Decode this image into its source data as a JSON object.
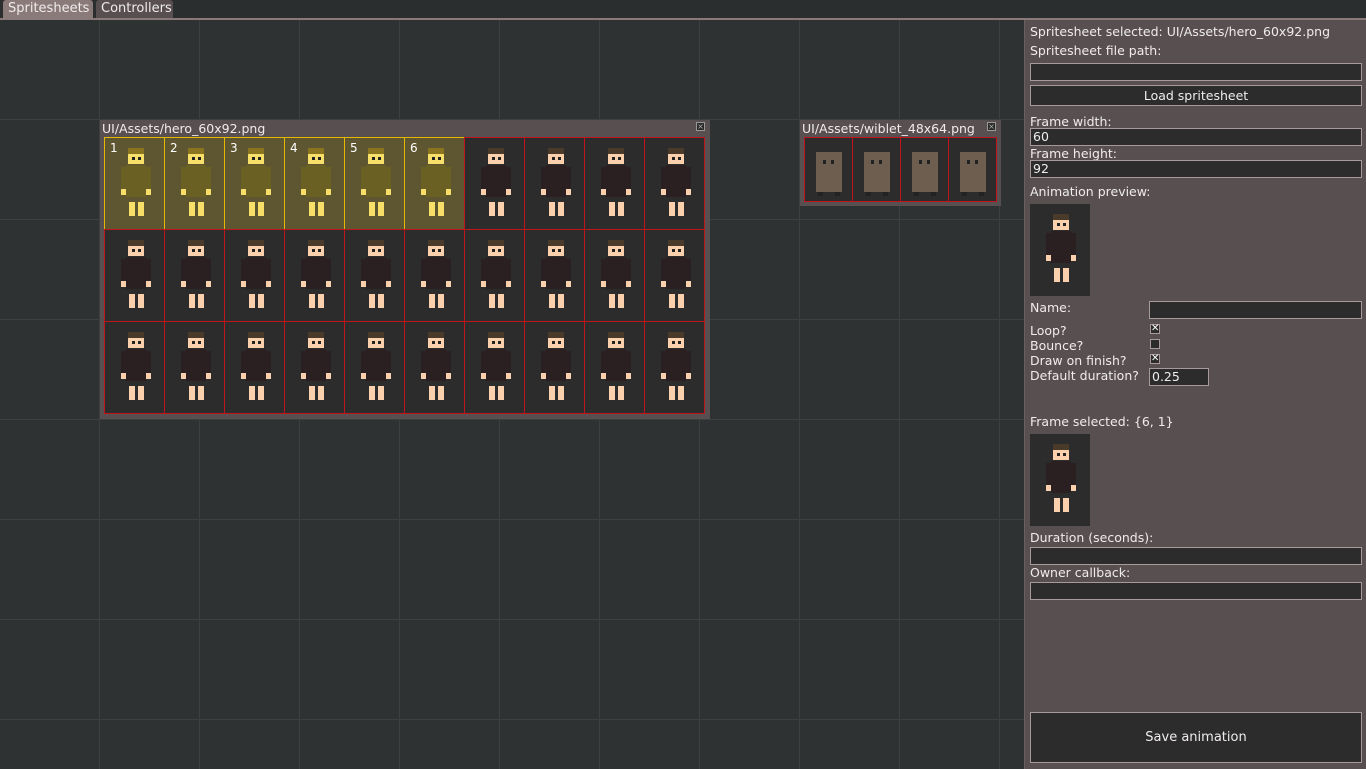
{
  "tabs": [
    {
      "label": "Spritesheets"
    },
    {
      "label": "Controllers"
    }
  ],
  "sheets": [
    {
      "title": "UI/Assets/hero_60x92.png",
      "cols": 10,
      "rows": 3,
      "selected_numbers": [
        "1",
        "2",
        "3",
        "4",
        "5",
        "6"
      ]
    },
    {
      "title": "UI/Assets/wiblet_48x64.png",
      "cols": 4,
      "rows": 1
    }
  ],
  "close_glyph": "×",
  "panel": {
    "spritesheet_selected": "Spritesheet selected: UI/Assets/hero_60x92.png",
    "file_path_label": "Spritesheet file path:",
    "file_path_value": "",
    "load_button": "Load spritesheet",
    "frame_width_label": "Frame width:",
    "frame_width_value": "60",
    "frame_height_label": "Frame height:",
    "frame_height_value": "92",
    "animation_preview_label": "Animation preview:",
    "name_label": "Name:",
    "name_value": "",
    "loop_label": "Loop?",
    "loop_checked": true,
    "bounce_label": "Bounce?",
    "bounce_checked": false,
    "draw_on_finish_label": "Draw on finish?",
    "draw_on_finish_checked": true,
    "default_duration_label": "Default duration?",
    "default_duration_value": "0.25",
    "frame_selected": "Frame selected: {6, 1}",
    "duration_label": "Duration (seconds):",
    "duration_value": "",
    "owner_callback_label": "Owner callback:",
    "owner_callback_value": "",
    "save_button": "Save animation",
    "check_glyph": "✕"
  }
}
